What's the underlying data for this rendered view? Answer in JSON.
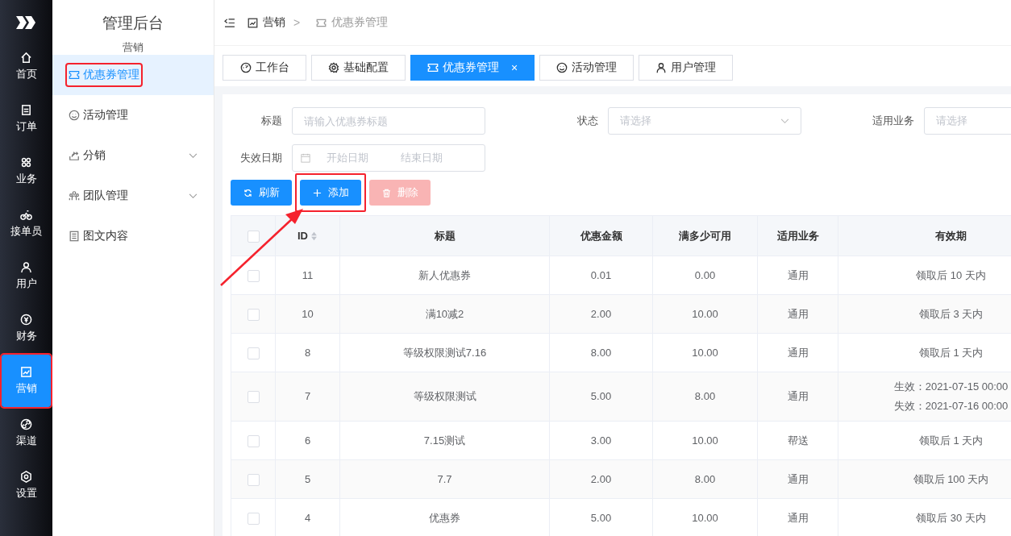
{
  "nav": [
    {
      "label": "首页",
      "selected": false,
      "highlighted": false
    },
    {
      "label": "订单",
      "selected": false,
      "highlighted": false
    },
    {
      "label": "业务",
      "selected": false,
      "highlighted": false
    },
    {
      "label": "接单员",
      "selected": false,
      "highlighted": false
    },
    {
      "label": "用户",
      "selected": false,
      "highlighted": false
    },
    {
      "label": "财务",
      "selected": false,
      "highlighted": false
    },
    {
      "label": "营销",
      "selected": true,
      "highlighted": true
    },
    {
      "label": "渠道",
      "selected": false,
      "highlighted": false
    },
    {
      "label": "设置",
      "selected": false,
      "highlighted": false
    }
  ],
  "sidebar": {
    "title": "管理后台",
    "section": "营销",
    "items": [
      {
        "label": "优惠券管理",
        "selected": true,
        "highlighted": true,
        "expandable": false
      },
      {
        "label": "活动管理",
        "selected": false,
        "highlighted": false,
        "expandable": false
      },
      {
        "label": "分销",
        "selected": false,
        "highlighted": false,
        "expandable": true
      },
      {
        "label": "团队管理",
        "selected": false,
        "highlighted": false,
        "expandable": true
      },
      {
        "label": "图文内容",
        "selected": false,
        "highlighted": false,
        "expandable": false
      }
    ]
  },
  "breadcrumb": [
    "营销",
    "优惠券管理"
  ],
  "breadcrumb_separator": ">",
  "tabs": [
    {
      "label": "工作台",
      "selected": false,
      "closable": false
    },
    {
      "label": "基础配置",
      "selected": false,
      "closable": false
    },
    {
      "label": "优惠券管理",
      "selected": true,
      "closable": true,
      "close": "×"
    },
    {
      "label": "活动管理",
      "selected": false,
      "closable": false
    },
    {
      "label": "用户管理",
      "selected": false,
      "closable": false
    }
  ],
  "filters": {
    "title": {
      "label": "标题",
      "placeholder": "请输入优惠券标题"
    },
    "status": {
      "label": "状态",
      "placeholder": "请选择"
    },
    "business": {
      "label": "适用业务",
      "placeholder": "请选择"
    },
    "expiry": {
      "label": "失效日期",
      "start_placeholder": "开始日期",
      "end_placeholder": "结束日期"
    }
  },
  "buttons": [
    {
      "label": "刷新",
      "kind": "primary",
      "disabled": false,
      "highlighted": false
    },
    {
      "label": "添加",
      "kind": "primary",
      "disabled": false,
      "highlighted": true
    },
    {
      "label": "删除",
      "kind": "danger",
      "disabled": true,
      "highlighted": false
    }
  ],
  "annotation_arrow": true,
  "table": {
    "select_all_checked": false,
    "columns": [
      "ID",
      "标题",
      "优惠金额",
      "满多少可用",
      "适用业务",
      "有效期"
    ],
    "rows": [
      {
        "checked": false,
        "id": "11",
        "title": "新人优惠券",
        "discount": "0.01",
        "minimum": "0.00",
        "business": "通用",
        "validity": [
          "领取后 10 天内"
        ]
      },
      {
        "checked": false,
        "id": "10",
        "title": "满10减2",
        "discount": "2.00",
        "minimum": "10.00",
        "business": "通用",
        "validity": [
          "领取后 3 天内"
        ]
      },
      {
        "checked": false,
        "id": "8",
        "title": "等级权限测试7.16",
        "discount": "8.00",
        "minimum": "10.00",
        "business": "通用",
        "validity": [
          "领取后 1 天内"
        ]
      },
      {
        "checked": false,
        "id": "7",
        "title": "等级权限测试",
        "discount": "5.00",
        "minimum": "8.00",
        "business": "通用",
        "validity": [
          "生效：2021-07-15 00:00",
          "失效：2021-07-16 00:00"
        ]
      },
      {
        "checked": false,
        "id": "6",
        "title": "7.15测试",
        "discount": "3.00",
        "minimum": "10.00",
        "business": "帮送",
        "validity": [
          "领取后 1 天内"
        ]
      },
      {
        "checked": false,
        "id": "5",
        "title": "7.7",
        "discount": "2.00",
        "minimum": "8.00",
        "business": "通用",
        "validity": [
          "领取后 100 天内"
        ]
      },
      {
        "checked": false,
        "id": "4",
        "title": "优惠券",
        "discount": "5.00",
        "minimum": "10.00",
        "business": "通用",
        "validity": [
          "领取后 30 天内"
        ]
      }
    ]
  }
}
